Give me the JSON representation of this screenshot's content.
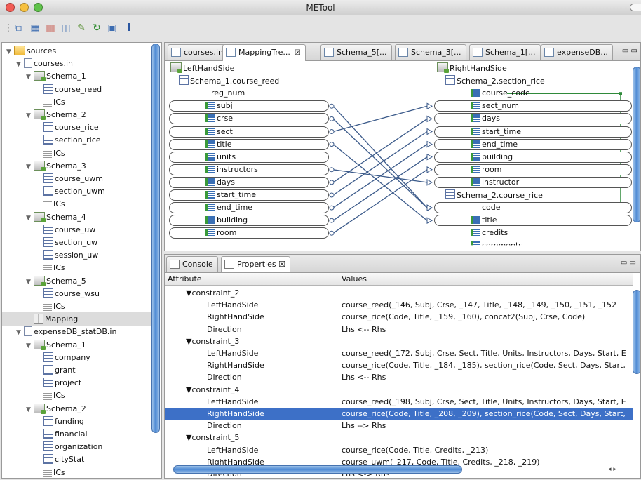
{
  "window": {
    "title": "METool"
  },
  "tree": {
    "rows": [
      {
        "indent": 0,
        "twisty": "▼",
        "icon": "folder",
        "label": "sources"
      },
      {
        "indent": 1,
        "twisty": "▼",
        "icon": "file",
        "label": "courses.in"
      },
      {
        "indent": 2,
        "twisty": "▼",
        "icon": "schema",
        "label": "Schema_1"
      },
      {
        "indent": 3,
        "twisty": "",
        "icon": "table",
        "label": "course_reed"
      },
      {
        "indent": 3,
        "twisty": "",
        "icon": "ics",
        "label": "ICs"
      },
      {
        "indent": 2,
        "twisty": "▼",
        "icon": "schema",
        "label": "Schema_2"
      },
      {
        "indent": 3,
        "twisty": "",
        "icon": "table",
        "label": "course_rice"
      },
      {
        "indent": 3,
        "twisty": "",
        "icon": "table",
        "label": "section_rice"
      },
      {
        "indent": 3,
        "twisty": "",
        "icon": "ics",
        "label": "ICs"
      },
      {
        "indent": 2,
        "twisty": "▼",
        "icon": "schema",
        "label": "Schema_3"
      },
      {
        "indent": 3,
        "twisty": "",
        "icon": "table",
        "label": "course_uwm"
      },
      {
        "indent": 3,
        "twisty": "",
        "icon": "table",
        "label": "section_uwm"
      },
      {
        "indent": 3,
        "twisty": "",
        "icon": "ics",
        "label": "ICs"
      },
      {
        "indent": 2,
        "twisty": "▼",
        "icon": "schema",
        "label": "Schema_4"
      },
      {
        "indent": 3,
        "twisty": "",
        "icon": "table",
        "label": "course_uw"
      },
      {
        "indent": 3,
        "twisty": "",
        "icon": "table",
        "label": "section_uw"
      },
      {
        "indent": 3,
        "twisty": "",
        "icon": "table",
        "label": "session_uw"
      },
      {
        "indent": 3,
        "twisty": "",
        "icon": "ics",
        "label": "ICs"
      },
      {
        "indent": 2,
        "twisty": "▼",
        "icon": "schema",
        "label": "Schema_5"
      },
      {
        "indent": 3,
        "twisty": "",
        "icon": "table",
        "label": "course_wsu"
      },
      {
        "indent": 3,
        "twisty": "",
        "icon": "ics",
        "label": "ICs"
      },
      {
        "indent": 2,
        "twisty": "",
        "icon": "mapping",
        "label": "Mapping",
        "selected": true
      },
      {
        "indent": 1,
        "twisty": "▼",
        "icon": "file",
        "label": "expenseDB_statDB.in"
      },
      {
        "indent": 2,
        "twisty": "▼",
        "icon": "schema",
        "label": "Schema_1"
      },
      {
        "indent": 3,
        "twisty": "",
        "icon": "table",
        "label": "company"
      },
      {
        "indent": 3,
        "twisty": "",
        "icon": "table",
        "label": "grant"
      },
      {
        "indent": 3,
        "twisty": "",
        "icon": "table",
        "label": "project"
      },
      {
        "indent": 3,
        "twisty": "",
        "icon": "ics",
        "label": "ICs"
      },
      {
        "indent": 2,
        "twisty": "▼",
        "icon": "schema",
        "label": "Schema_2"
      },
      {
        "indent": 3,
        "twisty": "",
        "icon": "table",
        "label": "funding"
      },
      {
        "indent": 3,
        "twisty": "",
        "icon": "table",
        "label": "financial"
      },
      {
        "indent": 3,
        "twisty": "",
        "icon": "table",
        "label": "organization"
      },
      {
        "indent": 3,
        "twisty": "",
        "icon": "table",
        "label": "cityStat"
      },
      {
        "indent": 3,
        "twisty": "",
        "icon": "ics",
        "label": "ICs"
      }
    ]
  },
  "editor": {
    "tabs": [
      {
        "label": "courses.in",
        "active": false,
        "close": ""
      },
      {
        "label": "MappingTre...",
        "active": true,
        "close": "☒"
      },
      {
        "label": "Schema_5[...",
        "active": false,
        "close": ""
      },
      {
        "label": "Schema_3[...",
        "active": false,
        "close": ""
      },
      {
        "label": "Schema_1[...",
        "active": false,
        "close": ""
      },
      {
        "label": "expenseDB...",
        "active": false,
        "close": ""
      }
    ],
    "minmax": "▭ ▭",
    "left": {
      "root": "LeftHandSide",
      "table": "Schema_1.course_reed",
      "key": "reg_num",
      "fields": [
        "subj",
        "crse",
        "sect",
        "title",
        "units",
        "instructors",
        "days",
        "start_time",
        "end_time",
        "building",
        "room"
      ]
    },
    "right": {
      "root": "RightHandSide",
      "table1": "Schema_2.section_rice",
      "fields1": [
        "course_code",
        "sect_num",
        "days",
        "start_time",
        "end_time",
        "building",
        "room",
        "instructor"
      ],
      "table2": "Schema_2.course_rice",
      "fields2": [
        "code",
        "title",
        "credits",
        "comments"
      ]
    }
  },
  "props": {
    "tabs": [
      {
        "label": "Console",
        "active": false
      },
      {
        "label": "Properties ☒",
        "active": true
      }
    ],
    "minmax": "▭ ▭",
    "headers": {
      "attribute": "Attribute",
      "values": "Values"
    },
    "rows": [
      {
        "attr": "▼constraint_2",
        "value": "",
        "group": true
      },
      {
        "attr": "LeftHandSide",
        "value": "course_reed(_146, Subj, Crse, _147, Title, _148, _149, _150, _151, _152"
      },
      {
        "attr": "RightHandSide",
        "value": "course_rice(Code, Title, _159, _160), concat2(Subj, Crse, Code)"
      },
      {
        "attr": "Direction",
        "value": "Lhs <-- Rhs"
      },
      {
        "attr": "▼constraint_3",
        "value": "",
        "group": true
      },
      {
        "attr": "LeftHandSide",
        "value": "course_reed(_172, Subj, Crse, Sect, Title, Units, Instructors, Days, Start, E"
      },
      {
        "attr": "RightHandSide",
        "value": "course_rice(Code, Title, _184, _185), section_rice(Code, Sect, Days, Start,"
      },
      {
        "attr": "Direction",
        "value": "Lhs <-- Rhs"
      },
      {
        "attr": "▼constraint_4",
        "value": "",
        "group": true
      },
      {
        "attr": "LeftHandSide",
        "value": "course_reed(_198, Subj, Crse, Sect, Title, Units, Instructors, Days, Start, E"
      },
      {
        "attr": "RightHandSide",
        "value": "course_rice(Code, Title, _208, _209), section_rice(Code, Sect, Days, Start,",
        "selected": true
      },
      {
        "attr": "Direction",
        "value": "Lhs --> Rhs"
      },
      {
        "attr": "▼constraint_5",
        "value": "",
        "group": true
      },
      {
        "attr": "LeftHandSide",
        "value": "course_rice(Code, Title, Credits, _213)"
      },
      {
        "attr": "RightHandSide",
        "value": "course_uwm(_217, Code, Title, Credits, _218, _219)"
      },
      {
        "attr": "Direction",
        "value": "Lhs <-> Rhs"
      }
    ],
    "hscroll_buttons": "◂ ▸"
  }
}
